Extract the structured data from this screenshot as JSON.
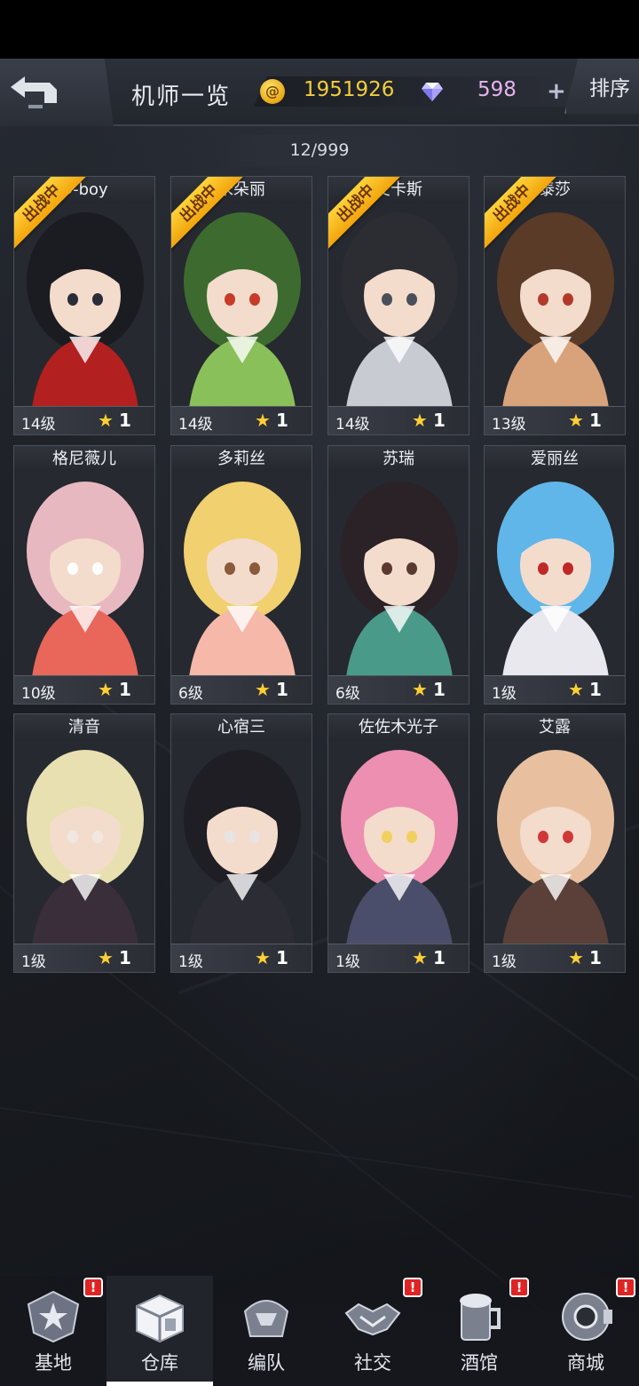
{
  "header": {
    "title": "机师一览",
    "coins": "1951926",
    "gems": "598",
    "plus_label": "+",
    "sort_label": "排序",
    "coin_symbol": "@"
  },
  "roster_count": "12/999",
  "cards": [
    {
      "name": "D-boy",
      "level": "14级",
      "stars": "1",
      "deployed": true,
      "ribbon": "出战中"
    },
    {
      "name": "米朵丽",
      "level": "14级",
      "stars": "1",
      "deployed": true,
      "ribbon": "出战中"
    },
    {
      "name": "艾卡斯",
      "level": "14级",
      "stars": "1",
      "deployed": true,
      "ribbon": "出战中"
    },
    {
      "name": "泰莎",
      "level": "13级",
      "stars": "1",
      "deployed": true,
      "ribbon": "出战中"
    },
    {
      "name": "格尼薇儿",
      "level": "10级",
      "stars": "1",
      "deployed": false
    },
    {
      "name": "多莉丝",
      "level": "6级",
      "stars": "1",
      "deployed": false
    },
    {
      "name": "苏瑞",
      "level": "6级",
      "stars": "1",
      "deployed": false
    },
    {
      "name": "爱丽丝",
      "level": "1级",
      "stars": "1",
      "deployed": false
    },
    {
      "name": "清音",
      "level": "1级",
      "stars": "1",
      "deployed": false
    },
    {
      "name": "心宿三",
      "level": "1级",
      "stars": "1",
      "deployed": false
    },
    {
      "name": "佐佐木光子",
      "level": "1级",
      "stars": "1",
      "deployed": false
    },
    {
      "name": "艾露",
      "level": "1级",
      "stars": "1",
      "deployed": false
    }
  ],
  "nav": {
    "items": [
      {
        "label": "基地",
        "icon": "base-icon",
        "badge": "!",
        "active": false
      },
      {
        "label": "仓库",
        "icon": "warehouse-icon",
        "badge": "",
        "active": true
      },
      {
        "label": "编队",
        "icon": "formation-icon",
        "badge": "",
        "active": false
      },
      {
        "label": "社交",
        "icon": "handshake-icon",
        "badge": "!",
        "active": false
      },
      {
        "label": "酒馆",
        "icon": "tavern-icon",
        "badge": "!",
        "active": false
      },
      {
        "label": "商城",
        "icon": "shop-icon",
        "badge": "!",
        "active": false
      }
    ]
  },
  "colors": {
    "coin": "#f3cd3c",
    "gem": "#e6b4f0",
    "ribbon": "#ffc21f",
    "badge": "#e02424"
  }
}
